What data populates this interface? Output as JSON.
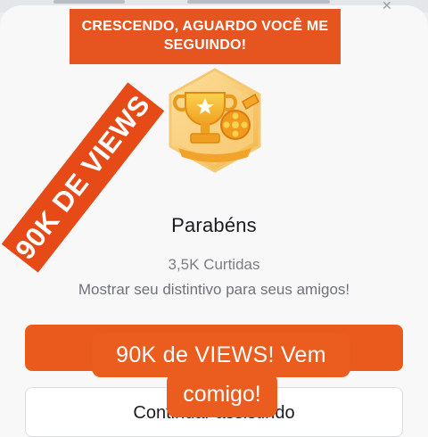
{
  "modal": {
    "title": "Parabéns",
    "likes": "3,5K Curtidas",
    "subtitle": "Mostrar seu distintivo para seus amigos!",
    "continue_label": "Continuar assistindo",
    "close_icon": "close-icon",
    "badge_icon": "trophy-film-badge-icon"
  },
  "overlays": {
    "top_banner": "CRESCENDO, AGUARDO VOCÊ ME SEGUINDO!",
    "diagonal_banner": "90K DE VIEWS",
    "caption_line1": "90K de VIEWS! Vem",
    "caption_line2": "comigo!"
  },
  "colors": {
    "accent": "#ea5a1d",
    "overlay_orange": "#e65420",
    "badge_gold": "#f0b338"
  }
}
